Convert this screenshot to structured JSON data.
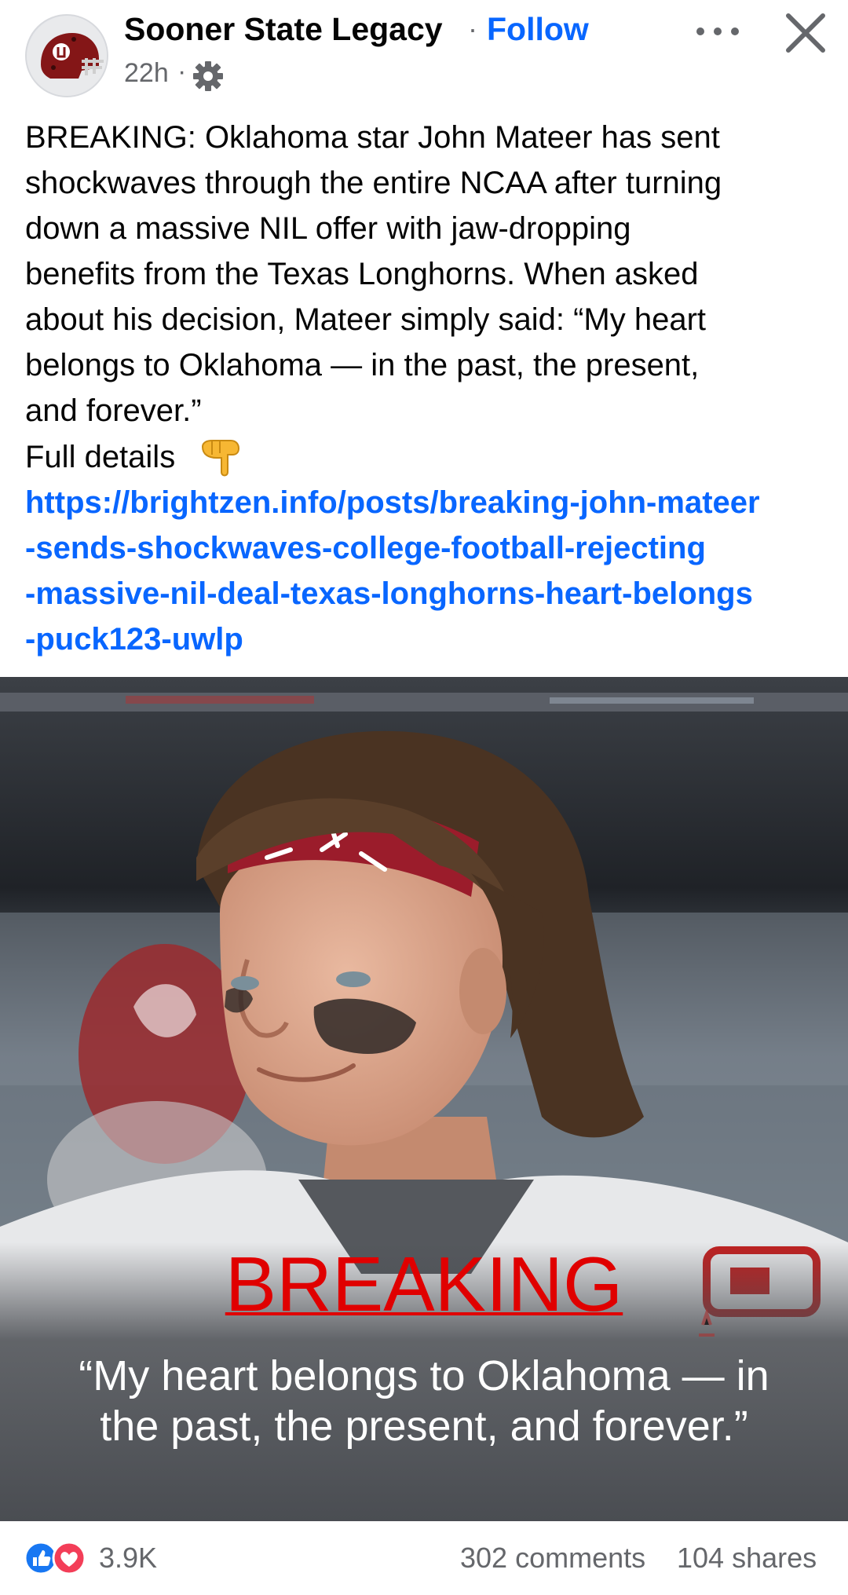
{
  "header": {
    "page_name": "Sooner State Legacy",
    "separator": "·",
    "follow_label": "Follow",
    "time": "22h",
    "time_separator": "·",
    "audience_icon": "gear-icon",
    "more_icon": "more-dots-icon",
    "close_icon": "close-icon"
  },
  "post": {
    "text_lines": [
      "BREAKING: Oklahoma star John Mateer has sent",
      "shockwaves through the entire NCAA after turning",
      "down a massive NIL offer with jaw-dropping",
      "benefits from the Texas Longhorns. When asked",
      "about his decision, Mateer simply said: “My heart",
      "belongs to Oklahoma — in the past, the present,",
      "and forever.”"
    ],
    "details_label": "Full details",
    "details_emoji": "pointing-down-hand-icon",
    "link_lines": [
      "https://brightzen.info/posts/breaking-john-mateer",
      "-sends-shockwaves-college-football-rejecting",
      "-massive-nil-deal-texas-longhorns-heart-belongs",
      "-puck123-uwlp"
    ]
  },
  "image": {
    "overlay_title": "BREAKING",
    "overlay_quote_line1": "“My heart belongs to Oklahoma — in",
    "overlay_quote_line2": "the past, the present, and forever.”"
  },
  "footer": {
    "reaction_icons": [
      "like-icon",
      "love-icon"
    ],
    "reaction_count": "3.9K",
    "comments": "302 comments",
    "shares": "104 shares"
  },
  "colors": {
    "link_blue": "#0866ff",
    "text_primary": "#050505",
    "text_secondary": "#65676b",
    "breaking_red": "#e00000",
    "crimson": "#841617"
  }
}
